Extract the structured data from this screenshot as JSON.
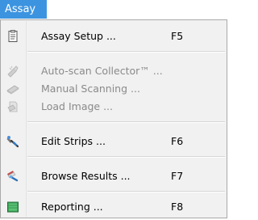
{
  "menu_title": "Assay",
  "items": [
    {
      "label": "Assay Setup ...",
      "shortcut": "F5",
      "icon": "document-list-icon"
    },
    {
      "label": "Auto-scan Collector™ ...",
      "shortcut": "",
      "icon": "auto-scan-icon"
    },
    {
      "label": "Manual Scanning ...",
      "shortcut": "",
      "icon": "manual-scan-icon"
    },
    {
      "label": "Load Image ...",
      "shortcut": "",
      "icon": "load-image-icon"
    },
    {
      "label": "Edit Strips ...",
      "shortcut": "F6",
      "icon": "edit-strips-icon"
    },
    {
      "label": "Browse Results ...",
      "shortcut": "F7",
      "icon": "browse-results-icon"
    },
    {
      "label": "Reporting ...",
      "shortcut": "F8",
      "icon": "reporting-icon"
    }
  ]
}
